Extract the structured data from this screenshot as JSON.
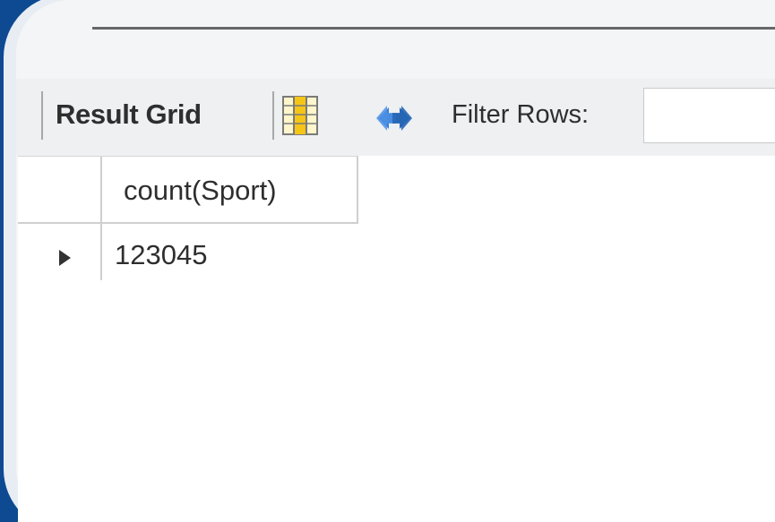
{
  "toolbar": {
    "result_grid_label": "Result Grid",
    "filter_label": "Filter Rows:",
    "filter_value": ""
  },
  "icons": {
    "grid": "grid-toggle-icon",
    "refresh": "refresh-icon"
  },
  "colors": {
    "background": "#0d4a91",
    "panel": "#f4f5f7",
    "grid_icon": "#f5c518",
    "refresh_icon": "#3a7fd6"
  },
  "grid": {
    "columns": [
      "count(Sport)"
    ],
    "rows": [
      [
        "123045"
      ]
    ]
  }
}
